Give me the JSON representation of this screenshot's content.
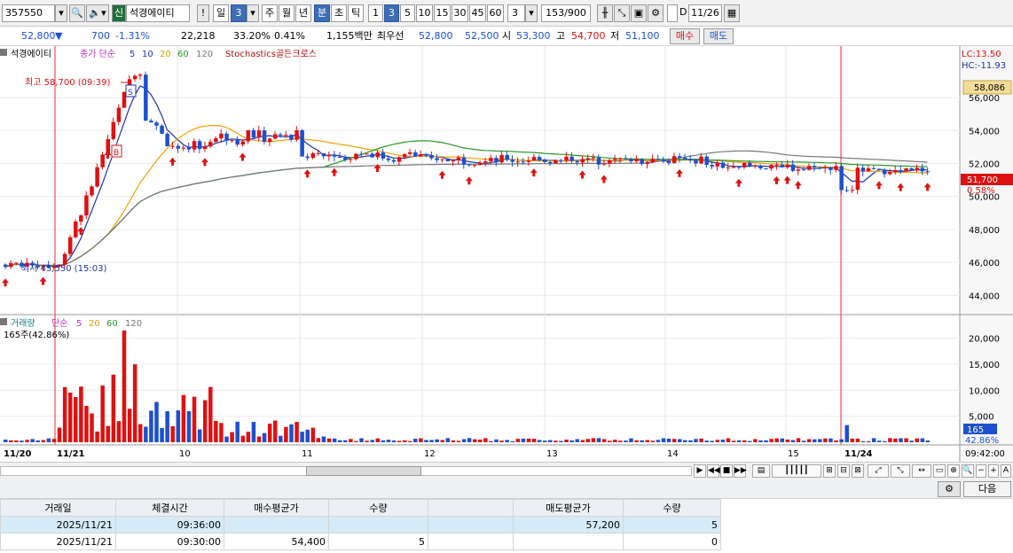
{
  "toolbar": {
    "code": "357550",
    "new_badge": "신",
    "stock_name": "석경에이티",
    "info_mark": "!",
    "periods": [
      "일",
      "주",
      "월",
      "년",
      "분",
      "초",
      "틱"
    ],
    "period_count": "3",
    "minute_buttons": [
      "1",
      "3",
      "5",
      "10",
      "15",
      "30",
      "45",
      "60"
    ],
    "interval_value": "3",
    "count_display": "153/900",
    "date_label": "D",
    "date_value": "11/26"
  },
  "quote": {
    "price": "52,800",
    "change": "700",
    "change_pct": "-1.31%",
    "volume": "22,218",
    "ratio": "33.20%",
    "turnover": "0.41%",
    "amount": "1,155백만",
    "best_label": "최우선",
    "best_ask": "52,800",
    "best_bid": "52,500",
    "open_label": "시",
    "open": "53,300",
    "high_label": "고",
    "high": "54,700",
    "low_label": "저",
    "low": "51,100",
    "buy_button": "매수",
    "sell_button": "매도"
  },
  "chart": {
    "legend_name": "석경에이티",
    "legend_ma_prefix": "종가 단순",
    "legend_ma_periods": [
      "5",
      "10",
      "20",
      "60",
      "120"
    ],
    "legend_stoch": "Stochastics골든크로스",
    "lc_label": "LC:13.50",
    "hc_label": "HC:-11.93",
    "high_marker": "최고 58,700 (09:39)",
    "low_marker": "최저 45,550 (15:03)",
    "current_price_tag": "51,700",
    "current_pct_tag": "0.58%",
    "ref_price_tag": "58,086",
    "price_ticks": [
      "56,000",
      "54,000",
      "52,000",
      "50,000",
      "48,000",
      "46,000",
      "44,000"
    ],
    "volume_legend_name": "거래량",
    "volume_ma_prefix": "단순",
    "volume_ma_periods": [
      "5",
      "20",
      "60",
      "120"
    ],
    "volume_info": "165주(42.86%)",
    "volume_ticks": [
      "20,000",
      "15,000",
      "10,000",
      "5,000"
    ],
    "volume_tag": "165",
    "volume_pct_tag": "42.86%",
    "x_labels": [
      "11/20",
      "11/21",
      "10",
      "11",
      "12",
      "13",
      "14",
      "15",
      "11/24"
    ],
    "time_label": "09:42:00"
  },
  "chart_data": {
    "type": "candlestick",
    "y_range": [
      43000,
      58800
    ],
    "session_high": 58700,
    "session_low": 45550,
    "last_price": 51700,
    "volume_range": [
      0,
      22000
    ]
  },
  "bottom_panel": {
    "next_button": "다음",
    "columns": [
      "거래일",
      "체결시간",
      "매수평균가",
      "수량",
      "",
      "매도평균가",
      "수량"
    ],
    "rows": [
      [
        "2025/11/21",
        "09:36:00",
        "",
        "",
        "",
        "57,200",
        "5"
      ],
      [
        "2025/11/21",
        "09:30:00",
        "54,400",
        "5",
        "",
        "",
        "0"
      ]
    ]
  },
  "colors": {
    "up": "#e01010",
    "down": "#1c50d0",
    "ma5": "#1d35a8",
    "ma20": "#f0a000",
    "ma60": "#2a9a2a",
    "ma120": "#777777"
  }
}
